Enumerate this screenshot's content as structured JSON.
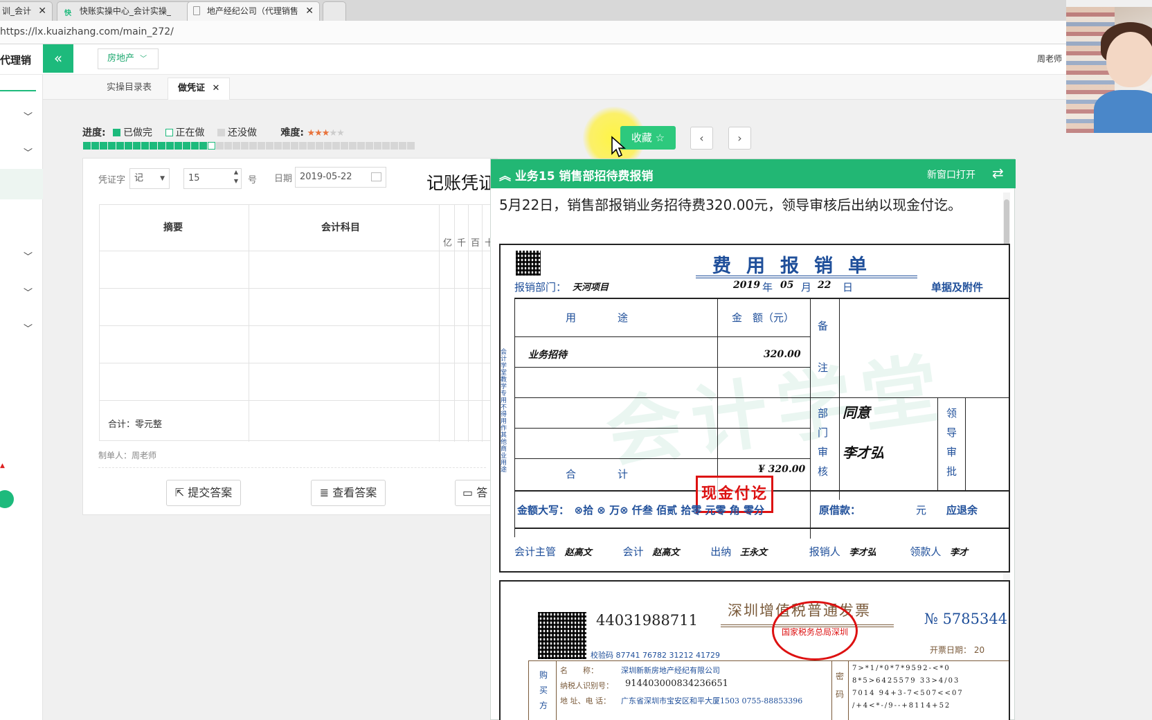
{
  "browser": {
    "tabs": [
      {
        "label": "训_会计",
        "active": false
      },
      {
        "label": "快账实操中心_会计实操_",
        "active": false
      },
      {
        "label": "地产经纪公司（代理销售",
        "active": true
      }
    ],
    "url": "https://lx.kuaizhang.com/main_272/"
  },
  "header": {
    "brand": "代理销",
    "category": "房地产",
    "user": "周老师"
  },
  "subtabs": [
    {
      "label": "实操目录表",
      "active": false
    },
    {
      "label": "做凭证",
      "active": true
    }
  ],
  "progress": {
    "label": "进度:",
    "done": "已做完",
    "doing": "正在做",
    "todo": "还没做",
    "difficulty_label": "难度:",
    "difficulty_stars": 3,
    "difficulty_max": 5,
    "done_count": 15,
    "current_index": 15,
    "total": 40,
    "colors": {
      "done": "#1dba7c",
      "doing": "#ffffff",
      "todo": "#d6d6d6"
    }
  },
  "toolbar": {
    "collect": "收藏",
    "prev": "‹",
    "next": "›"
  },
  "voucher": {
    "type_label": "凭证字",
    "type_value": "记",
    "number_value": "15",
    "number_suffix": "号",
    "date_label": "日期",
    "date_value": "2019-05-22",
    "title": "记账凭证",
    "col_summary": "摘要",
    "col_account": "会计科目",
    "units": "亿千百十",
    "total": "合计：零元整",
    "maker": "制单人：周老师",
    "btn_submit": "提交答案",
    "btn_view": "查看答案",
    "btn_third": "答"
  },
  "panel": {
    "title": "业务15 销售部招待费报销",
    "open_new": "新窗口打开",
    "description": "5月22日，销售部报销业务招待费320.00元，领导审核后出纳以现金付讫。",
    "form": {
      "title": "费用报销单",
      "dept_label": "报销部门：",
      "dept_value": "天河项目",
      "date_year": "2019",
      "date_month": "05",
      "date_day": "22",
      "date_units": [
        "年",
        "月",
        "日"
      ],
      "attach_label": "单据及附件",
      "col_use": "用　　　　途",
      "col_amount": "金　额（元）",
      "remark": [
        "备",
        "注"
      ],
      "row1_use": "业务招待",
      "row1_amount": "320.00",
      "total_label": "合　　　　计",
      "total_amount": "¥ 320.00",
      "dept_review": [
        "部",
        "门",
        "审",
        "核"
      ],
      "dept_review_text": [
        "同意",
        "李才弘"
      ],
      "leader": [
        "领",
        "导",
        "审",
        "批"
      ],
      "amount_words": "金额大写：　⊗拾 ⊗ 万⊗ 仟叁 佰贰 拾零 元零 角 零分",
      "original_loan": "原借款：",
      "yuan": "元",
      "refund": "应退余",
      "stamp": "现金付讫",
      "watermark": "会计学堂",
      "side_note": "会计学堂教学专用不得用作其他商业用途",
      "footer": {
        "chief_label": "会计主管",
        "chief": "赵高文",
        "accountant_label": "会计",
        "accountant": "赵高文",
        "cashier_label": "出纳",
        "cashier": "王永文",
        "claimant_label": "报销人",
        "claimant": "李才弘",
        "receiver_label": "领款人",
        "receiver": "李才"
      }
    },
    "invoice": {
      "code": "44031988711",
      "title": "深圳增值税普通发票",
      "no_symbol": "№",
      "number": "5785344",
      "date_label": "开票日期：",
      "date_value": "20",
      "check_code": "校验码 87741 76782 31212 41729",
      "seal_text": "国家税务总局深圳",
      "buyer_labels": [
        "购",
        "买",
        "方"
      ],
      "name_label": "名　　称：",
      "name_value": "深圳新新房地产经纪有限公司",
      "tax_label": "纳税人识别号：",
      "tax_value": "914403000834236651",
      "addr_label": "地 址、电 话：",
      "addr_value": "广东省深圳市宝安区和平大厦1503 0755-88853396",
      "cipher_label": [
        "密",
        "码"
      ],
      "cipher_rows": [
        "7>*1/*0*7*9592-<*0",
        "8*5>6425579 33>4/03",
        "7014 94+3-7<507<<07",
        "/+4<*-/9--+8114+52"
      ]
    }
  }
}
